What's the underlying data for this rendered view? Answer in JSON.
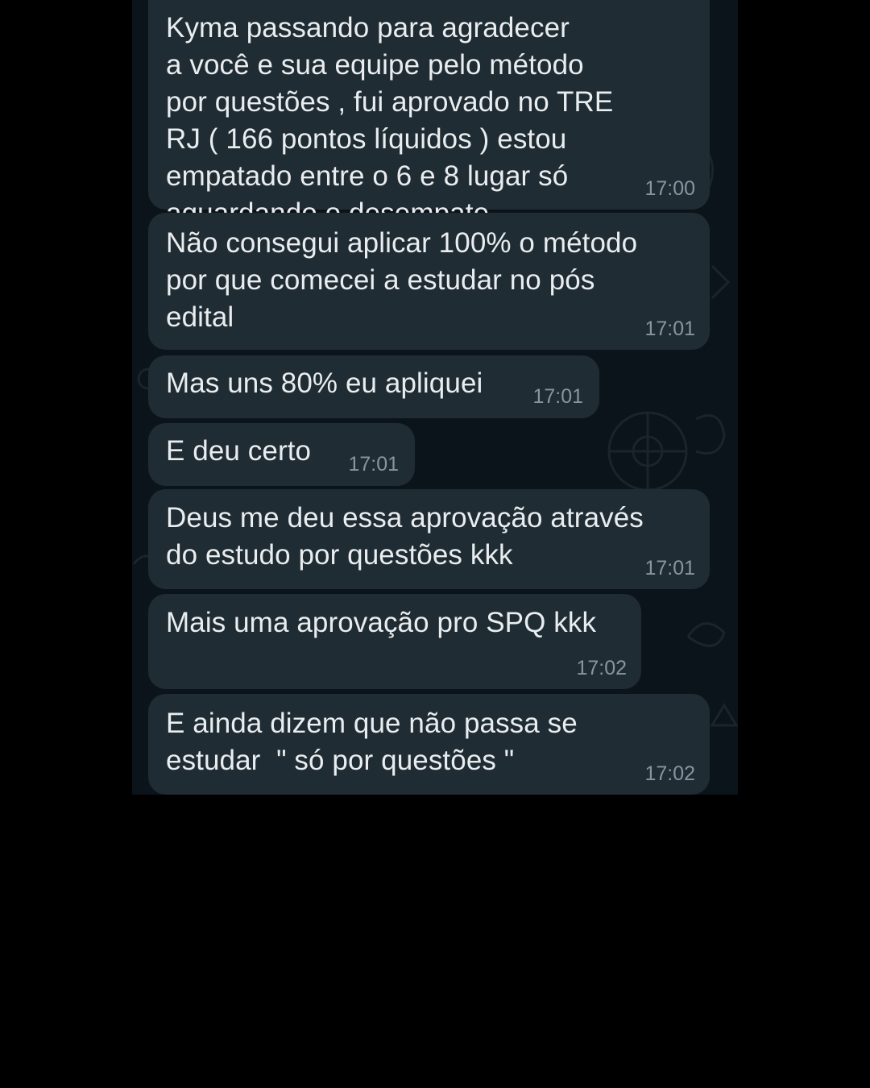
{
  "colors": {
    "background": "#000000",
    "chat_background": "#0b141a",
    "bubble": "#202c33",
    "text": "#e9edef",
    "timestamp": "#8696a0"
  },
  "messages": [
    {
      "text": "Kyma passando para agradecer\na você e sua equipe pelo método\npor questões , fui aprovado no TRE\nRJ ( 166 pontos líquidos ) estou\nempatado entre o 6 e 8 lugar só\naguardando o desempate",
      "time": "17:00"
    },
    {
      "text": "Não consegui aplicar 100% o método\npor que comecei a estudar no pós\nedital",
      "time": "17:01"
    },
    {
      "text": "Mas uns 80% eu apliquei",
      "time": "17:01"
    },
    {
      "text": "E deu certo",
      "time": "17:01"
    },
    {
      "text": "Deus me deu essa aprovação através\ndo estudo por questões kkk",
      "time": "17:01"
    },
    {
      "text": "Mais uma aprovação pro SPQ kkk",
      "time": "17:02"
    },
    {
      "text": "E ainda dizem que não passa se\nestudar  \" só por questões \"",
      "time": "17:02"
    }
  ]
}
